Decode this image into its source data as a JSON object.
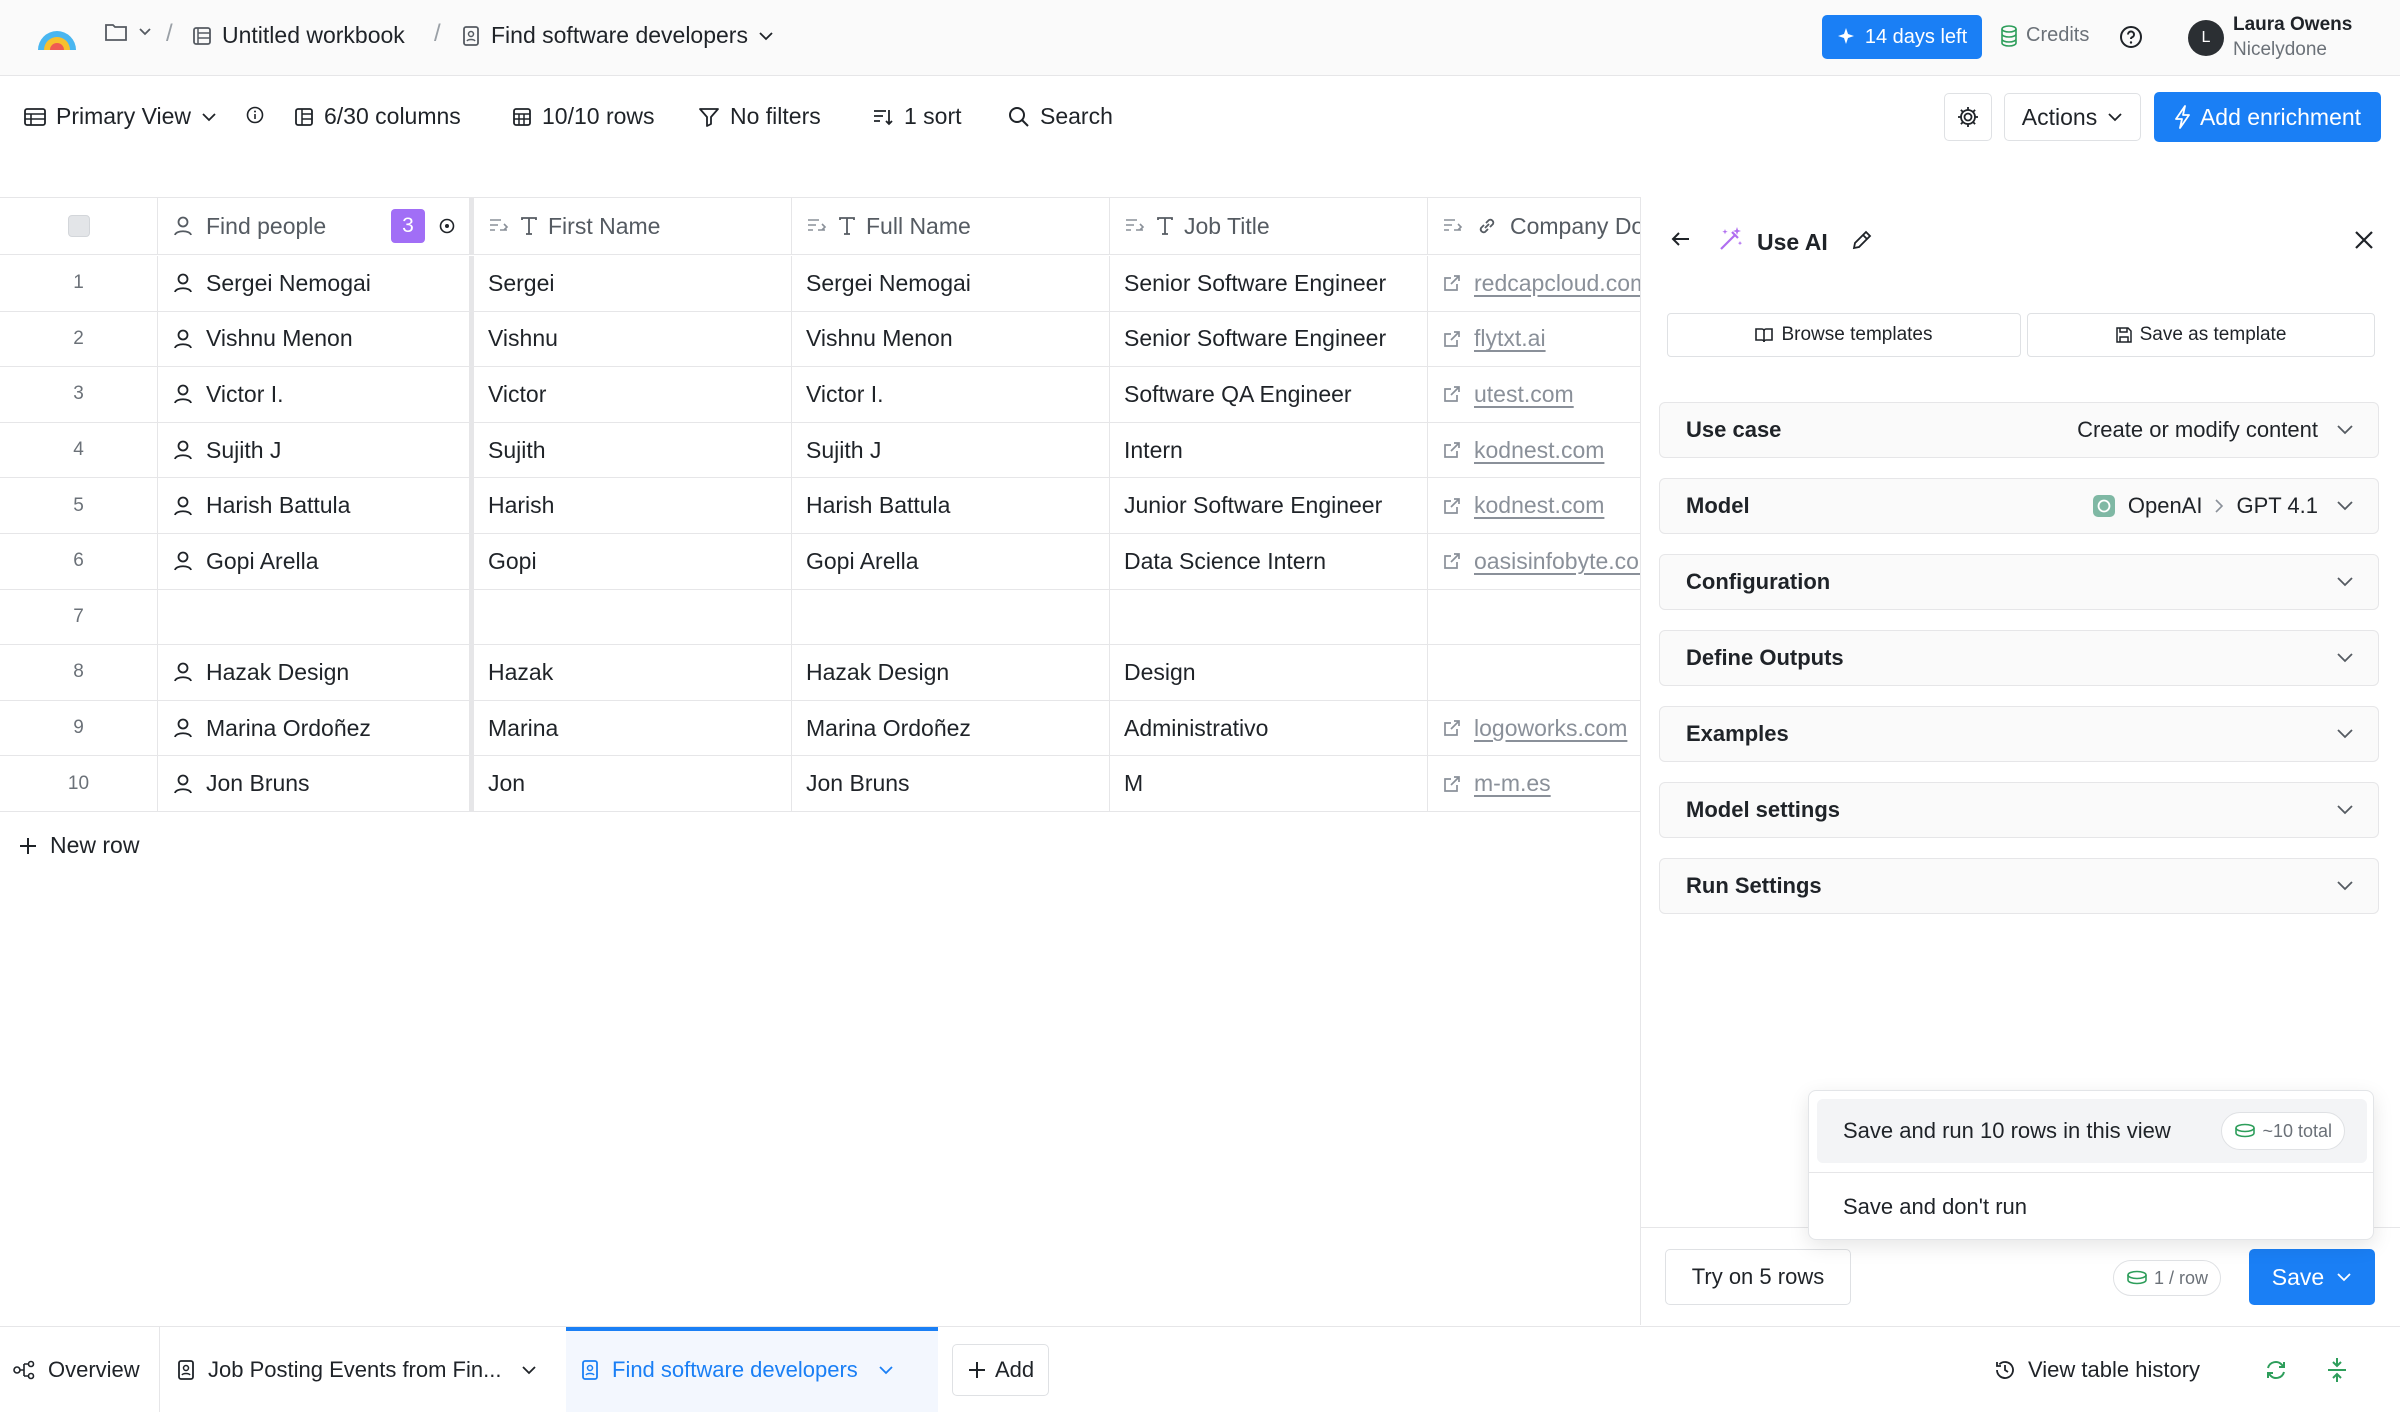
{
  "header": {
    "workbook": "Untitled workbook",
    "table_name": "Find software developers",
    "trial": "14 days left",
    "credits": "Credits",
    "user": {
      "initial": "L",
      "name": "Laura Owens",
      "org": "Nicelydone"
    }
  },
  "toolbar": {
    "view": "Primary View",
    "columns": "6/30 columns",
    "rows": "10/10 rows",
    "filters": "No filters",
    "sort": "1 sort",
    "search": "Search",
    "actions": "Actions",
    "add_enrichment": "Add enrichment"
  },
  "table": {
    "headers": [
      "Find people",
      "First Name",
      "Full Name",
      "Job Title",
      "Company Do"
    ],
    "find_people_badge": "3",
    "rows": [
      {
        "n": "1",
        "person": "Sergei Nemogai",
        "first": "Sergei",
        "full": "Sergei Nemogai",
        "title": "Senior Software Engineer",
        "domain": "redcapcloud.com"
      },
      {
        "n": "2",
        "person": "Vishnu Menon",
        "first": "Vishnu",
        "full": "Vishnu Menon",
        "title": "Senior Software Engineer",
        "domain": "flytxt.ai"
      },
      {
        "n": "3",
        "person": "Victor I.",
        "first": "Victor",
        "full": "Victor I.",
        "title": "Software QA Engineer",
        "domain": "utest.com"
      },
      {
        "n": "4",
        "person": "Sujith J",
        "first": "Sujith",
        "full": "Sujith J",
        "title": "Intern",
        "domain": "kodnest.com"
      },
      {
        "n": "5",
        "person": "Harish Battula",
        "first": "Harish",
        "full": "Harish Battula",
        "title": "Junior Software Engineer",
        "domain": "kodnest.com"
      },
      {
        "n": "6",
        "person": "Gopi Arella",
        "first": "Gopi",
        "full": "Gopi Arella",
        "title": "Data Science Intern",
        "domain": "oasisinfobyte.com"
      },
      {
        "n": "7",
        "person": "",
        "first": "",
        "full": "",
        "title": "",
        "domain": ""
      },
      {
        "n": "8",
        "person": "Hazak Design",
        "first": "Hazak",
        "full": "Hazak Design",
        "title": "Design",
        "domain": ""
      },
      {
        "n": "9",
        "person": "Marina Ordoñez",
        "first": "Marina",
        "full": "Marina Ordoñez",
        "title": "Administrativo",
        "domain": "logoworks.com"
      },
      {
        "n": "10",
        "person": "Jon Bruns",
        "first": "Jon",
        "full": "Jon Bruns",
        "title": "M",
        "domain": "m-m.es"
      }
    ],
    "new_row": "New row"
  },
  "panel": {
    "title": "Use AI",
    "browse_templates": "Browse templates",
    "save_template": "Save as template",
    "sections": [
      {
        "label": "Use case",
        "value": "Create or modify content"
      },
      {
        "label": "Model",
        "provider": "OpenAI",
        "value": "GPT 4.1"
      },
      {
        "label": "Configuration"
      },
      {
        "label": "Define Outputs"
      },
      {
        "label": "Examples"
      },
      {
        "label": "Model settings"
      },
      {
        "label": "Run Settings"
      }
    ],
    "dropdown": {
      "run_label": "Save and run 10 rows in this view",
      "run_cost": "~10 total",
      "no_run_label": "Save and don't run"
    },
    "try_rows": "Try on 5 rows",
    "cost_per_row": "1 / row",
    "save": "Save"
  },
  "bottom": {
    "overview": "Overview",
    "tab1": "Job Posting Events from Fin...",
    "tab2": "Find software developers",
    "add": "Add",
    "history": "View table history"
  },
  "colors": {
    "accent": "#1a7ff5",
    "badge": "#a16ef6",
    "ai_icon": "#b06ef0",
    "green": "#2e9e5b"
  }
}
